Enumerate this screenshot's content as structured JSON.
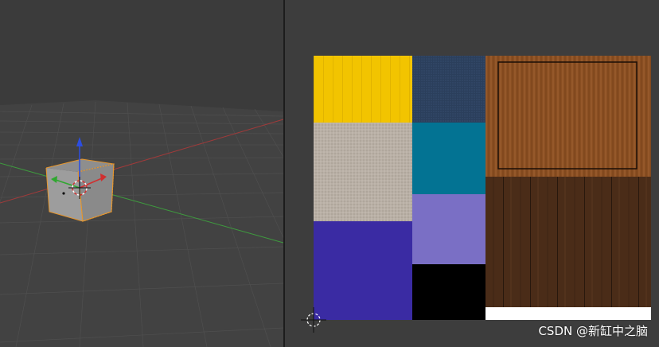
{
  "viewport_3d": {
    "background": "#3b3b3b",
    "grid_color": "#4c4c4c",
    "x_axis_color": "#a23a3a",
    "y_axis_color": "#3e9b3e",
    "object": "cube",
    "object_selected": true,
    "selection_outline_color": "#e8962a",
    "gizmo_z_color": "#2c4de0",
    "gizmo_x_color": "#d12f2f",
    "gizmo_y_color": "#2fa82f",
    "cursor_icon": "3d-cursor-icon"
  },
  "uv_editor": {
    "background": "#3d3d3d",
    "cursor_icon": "2d-cursor-icon",
    "texture_tiles": [
      {
        "name": "yellow-planks",
        "color": "#f2c400"
      },
      {
        "name": "blue-fabric",
        "color": "#2b3f5c"
      },
      {
        "name": "wood-framed",
        "color": "#8a4f22"
      },
      {
        "name": "beige-carpet",
        "color": "#b9b0a6"
      },
      {
        "name": "teal",
        "color": "#037393"
      },
      {
        "name": "indigo",
        "color": "#3a2ba3"
      },
      {
        "name": "lavender",
        "color": "#7a6fc5"
      },
      {
        "name": "dark-wood",
        "color": "#4a2c18"
      },
      {
        "name": "black",
        "color": "#000000"
      },
      {
        "name": "white-strip",
        "color": "#ffffff"
      }
    ]
  },
  "watermark": {
    "text": "CSDN @新缸中之脑"
  }
}
